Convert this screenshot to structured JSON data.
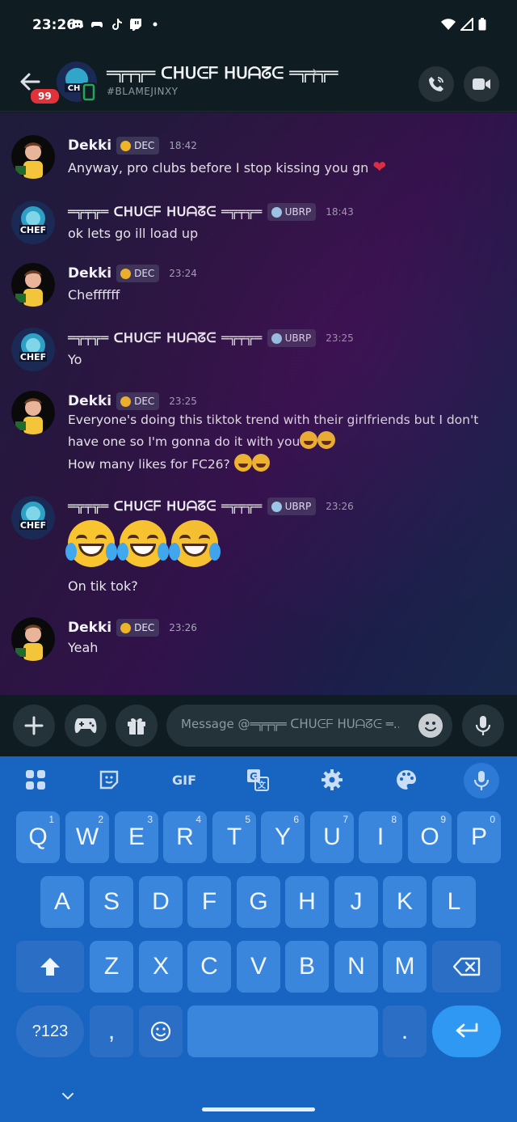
{
  "status_bar": {
    "time": "23:26"
  },
  "header": {
    "unread_badge": "99",
    "name": "═╦╤╦═ ᑕᕼᑌᕮᖴ ᕼᑌᗩᘔᕮ ═╦╤╦═",
    "chevron": "›",
    "tag": "#BLAMEJINXY"
  },
  "colors": {
    "accent_red": "#e0323b",
    "heart": "#e5303d",
    "keyboard_bg": "#1865c1",
    "key_bg": "#3b86dd",
    "enter_bg": "#2f98f2"
  },
  "messages": [
    {
      "author": "Dekki",
      "tag": "DEC",
      "time": "18:42",
      "lines": [
        "Anyway, pro clubs before I stop kissing you gn"
      ]
    },
    {
      "author": "═╦╤╦═ ᑕᕼᑌᕮᖴ ᕼᑌᗩᘔᕮ ═╦╤╦═",
      "tag": "UBRP",
      "time": "18:43",
      "lines": [
        "ok lets go ill load up"
      ]
    },
    {
      "author": "Dekki",
      "tag": "DEC",
      "time": "23:24",
      "lines": [
        "Cheffffff"
      ]
    },
    {
      "author": "═╦╤╦═ ᑕᕼᑌᕮᖴ ᕼᑌᗩᘔᕮ ═╦╤╦═",
      "tag": "UBRP",
      "time": "23:25",
      "lines": [
        "Yo"
      ]
    },
    {
      "author": "Dekki",
      "tag": "DEC",
      "time": "23:25",
      "lines": [
        "Everyone's doing this tiktok trend with their girlfriends but I don't have one so I'm gonna do it with you",
        "How many likes for FC26?"
      ]
    },
    {
      "author": "═╦╤╦═ ᑕᕼᑌᕮᖴ ᕼᑌᗩᘔᕮ ═╦╤╦═",
      "tag": "UBRP",
      "time": "23:26",
      "lines": [
        "On tik tok?"
      ]
    },
    {
      "author": "Dekki",
      "tag": "DEC",
      "time": "23:26",
      "lines": [
        "Yeah"
      ]
    }
  ],
  "composer": {
    "placeholder": "Message @═╦╤╦═ ᑕᕼᑌᕮᖴ ᕼᑌᗩᘔᕮ ═..."
  },
  "keyboard": {
    "toolbar_gif": "GIF",
    "row1": [
      [
        "Q",
        "1"
      ],
      [
        "W",
        "2"
      ],
      [
        "E",
        "3"
      ],
      [
        "R",
        "4"
      ],
      [
        "T",
        "5"
      ],
      [
        "Y",
        "6"
      ],
      [
        "U",
        "7"
      ],
      [
        "I",
        "8"
      ],
      [
        "O",
        "9"
      ],
      [
        "P",
        "0"
      ]
    ],
    "row2": [
      "A",
      "S",
      "D",
      "F",
      "G",
      "H",
      "J",
      "K",
      "L"
    ],
    "row3": [
      "Z",
      "X",
      "C",
      "V",
      "B",
      "N",
      "M"
    ],
    "symbols_key": "?123",
    "comma_key": ",",
    "period_key": "."
  }
}
